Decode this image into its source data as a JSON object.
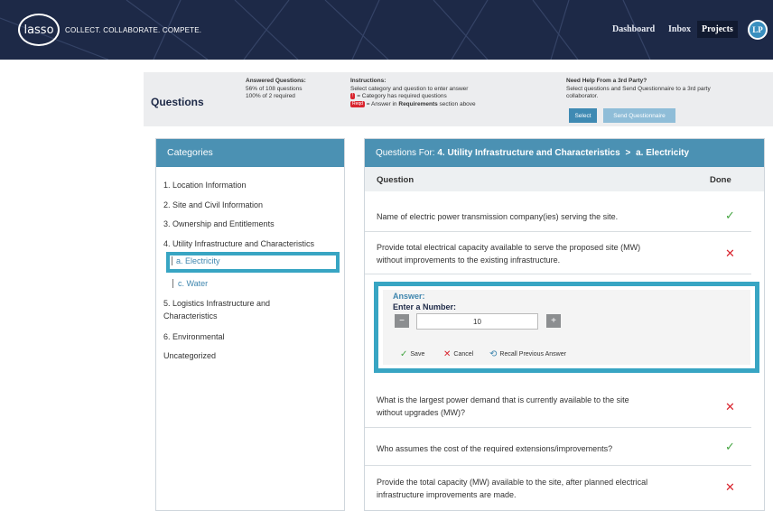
{
  "header": {
    "logo_text": "lasso",
    "tagline": "COLLECT. COLLABORATE. COMPETE.",
    "nav": [
      "Dashboard",
      "Inbox",
      "Projects"
    ],
    "avatar_initials": "LP"
  },
  "infobar": {
    "title": "Questions",
    "answered": {
      "heading": "Answered Questions:",
      "line1": "56% of 108 questions",
      "line2": "100% of 2 required"
    },
    "instructions": {
      "heading": "Instructions:",
      "line1": "Select category and question to enter answer",
      "line2": "= Category has required questions",
      "line3_pre": "= Answer in",
      "line3_bold": "Requirements",
      "line3_post": "section above",
      "badge_small": "!",
      "badge_req": "Reqd"
    },
    "help": {
      "heading": "Need Help From a 3rd Party?",
      "line1": "Select questions and Send Questionnaire to a 3rd party",
      "line2": "collaborator.",
      "select_label": "Select",
      "send_label": "Send Questionnaire"
    }
  },
  "categories": {
    "heading": "Categories",
    "items": [
      "1. Location Information",
      "2. Site and Civil Information",
      "3. Ownership and Entitlements",
      "4. Utility Infrastructure and Characteristics",
      "5. Logistics Infrastructure and",
      "Characteristics",
      "6. Environmental",
      "Uncategorized"
    ],
    "subitems": [
      "a. Electricity",
      "c. Water"
    ]
  },
  "questions": {
    "head_prefix": "Questions For:",
    "head_category": "4. Utility Infrastructure and Characteristics",
    "head_sep": ">",
    "head_sub": "a. Electricity",
    "col_question": "Question",
    "col_done": "Done",
    "rows": [
      {
        "line1": "Name of electric power transmission company(ies) serving the site.",
        "line2": "",
        "done": true
      },
      {
        "line1": "Provide total electrical capacity available to serve the proposed site (MW)",
        "line2": "without improvements to the existing infrastructure.",
        "done": false
      },
      {
        "line1": "What is the largest power demand that is currently available to the site",
        "line2": "without upgrades (MW)?",
        "done": false
      },
      {
        "line1": "Who assumes the cost of the required extensions/improvements?",
        "line2": "",
        "done": true
      },
      {
        "line1": "Provide the total capacity (MW) available to the site, after planned electrical",
        "line2": "infrastructure improvements are made.",
        "done": false
      }
    ],
    "done_icon": "check-icon",
    "not_done_icon": "x-icon",
    "ok_color": "#45a542",
    "no_color": "#d9252f"
  },
  "answer": {
    "label": "Answer:",
    "prompt": "Enter a Number:",
    "minus": "−",
    "plus": "+",
    "value": "10",
    "save": "Save",
    "cancel": "Cancel",
    "recall": "Recall Previous Answer"
  },
  "colors": {
    "header_bg": "#1d2947",
    "panel_head": "#4b91b3",
    "highlight": "#38a5c3"
  }
}
